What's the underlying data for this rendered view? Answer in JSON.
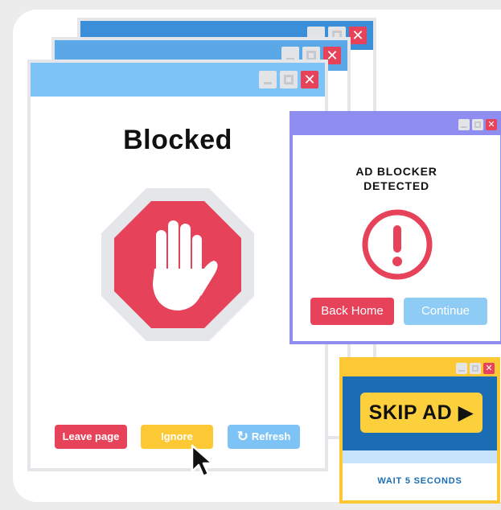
{
  "colors": {
    "page_bg": "#ececec",
    "card_bg": "#ffffff",
    "window_blue_dark": "#3b8fd8",
    "window_blue_mid": "#5aa8e8",
    "window_blue_light": "#7ec3f5",
    "window_purple": "#8f8ef0",
    "window_yellow": "#fcc934",
    "close_red": "#e6435b",
    "stop_red": "#e6435b",
    "ignore_yellow": "#fcc934",
    "refresh_blue": "#7ec3f5",
    "skip_panel_blue": "#1a6cb5"
  },
  "icons": {
    "stop": "hand-stop-icon",
    "alert": "exclamation-circle-icon",
    "refresh": "refresh-icon",
    "cursor": "mouse-pointer-icon",
    "play": "play-triangle-icon"
  },
  "blocked_window": {
    "title": "Blocked",
    "buttons": {
      "leave": "Leave page",
      "ignore": "Ignore",
      "refresh": "Refresh"
    }
  },
  "adblock_popup": {
    "heading_line1": "AD BLOCKER",
    "heading_line2": "DETECTED",
    "back_home": "Back Home",
    "continue": "Continue"
  },
  "skip_ad_popup": {
    "skip_label": "SKIP AD ▶",
    "wait_text": "WAIT 5 SECONDS"
  }
}
